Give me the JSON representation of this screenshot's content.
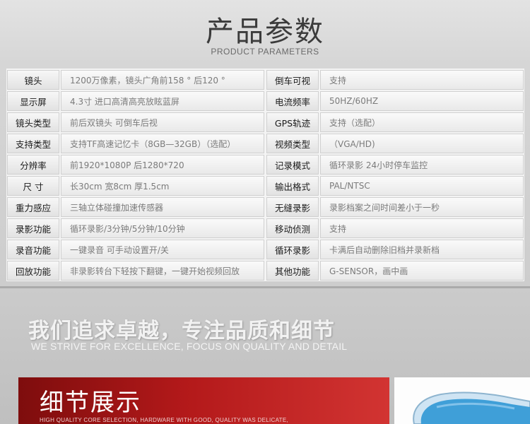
{
  "header": {
    "title": "产品参数",
    "subtitle": "PRODUCT PARAMETERS"
  },
  "params": [
    [
      {
        "label": "镜头",
        "value": "1200万像素，镜头广角前158 °  后120 °"
      },
      {
        "label": "倒车可视",
        "value": "支持"
      }
    ],
    [
      {
        "label": "显示屏",
        "value": "4.3寸 进口高清高亮放眩蓝屏"
      },
      {
        "label": "电流频率",
        "value": "50HZ/60HZ"
      }
    ],
    [
      {
        "label": "镜头类型",
        "value": "前后双镜头   可倒车后视"
      },
      {
        "label": "GPS轨迹",
        "value": "支持（选配）"
      }
    ],
    [
      {
        "label": "支持类型",
        "value": "支持TF高速记忆卡（8GB—32GB）（选配）"
      },
      {
        "label": "视频类型",
        "value": "（VGA/HD)"
      }
    ],
    [
      {
        "label": "分辨率",
        "value": "前1920*1080P 后1280*720"
      },
      {
        "label": "记录模式",
        "value": "循环录影     24小时停车监控"
      }
    ],
    [
      {
        "label": "尺  寸",
        "value": "长30cm    宽8cm     厚1.5cm"
      },
      {
        "label": "输出格式",
        "value": "PAL/NTSC"
      }
    ],
    [
      {
        "label": "重力感应",
        "value": "三轴立体碰撞加速传感器"
      },
      {
        "label": "无缝录影",
        "value": "录影档案之间时间差小于一秒"
      }
    ],
    [
      {
        "label": "录影功能",
        "value": "循环录影/3分钟/5分钟/10分钟"
      },
      {
        "label": "移动侦测",
        "value": "支持"
      }
    ],
    [
      {
        "label": "录音功能",
        "value": "一键录音  可手动设置开/关"
      },
      {
        "label": "循环录影",
        "value": "卡满后自动删除旧档并录新档"
      }
    ],
    [
      {
        "label": "回放功能",
        "value": "非录影转台下轻按下翻键，一键开始视频回放"
      },
      {
        "label": "其他功能",
        "value": "G-SENSOR，画中画"
      }
    ]
  ],
  "slogan": {
    "cn": "我们追求卓越，专注品质和细节",
    "en": "WE STRIVE FOR EXCELLENCE, FOCUS ON QUALITY AND DETAIL"
  },
  "detail": {
    "title": "细节展示",
    "subtitle": "HIGH QUALITY CORE SELECTION, HARDWARE WITH GOOD, QUALITY WAS DELICATE,"
  },
  "colors": {
    "banner_red": "#b3191a",
    "product_blue": "#3f9fd8"
  }
}
